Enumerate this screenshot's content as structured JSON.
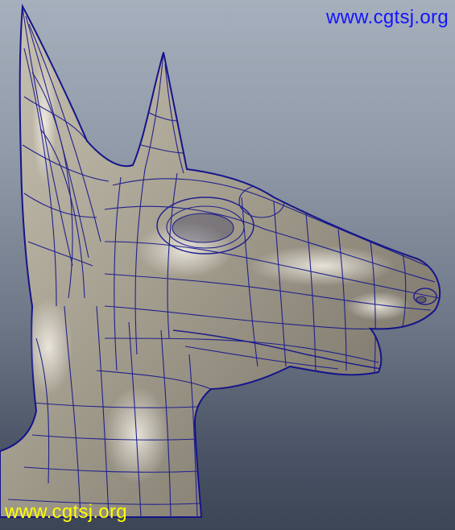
{
  "viewport": {
    "watermark_top": "www.cgtsj.org",
    "watermark_bottom": "www.cgtsj.org"
  },
  "model": {
    "subject": "jackal-head-wireframe",
    "surface_color": "#a39d8e",
    "wire_color": "#1a1a8c"
  },
  "colors": {
    "watermark_top": "#1414ff",
    "watermark_bottom": "#ffff00",
    "background_top": "#a6b0bd",
    "background_bottom": "#3c4556"
  }
}
